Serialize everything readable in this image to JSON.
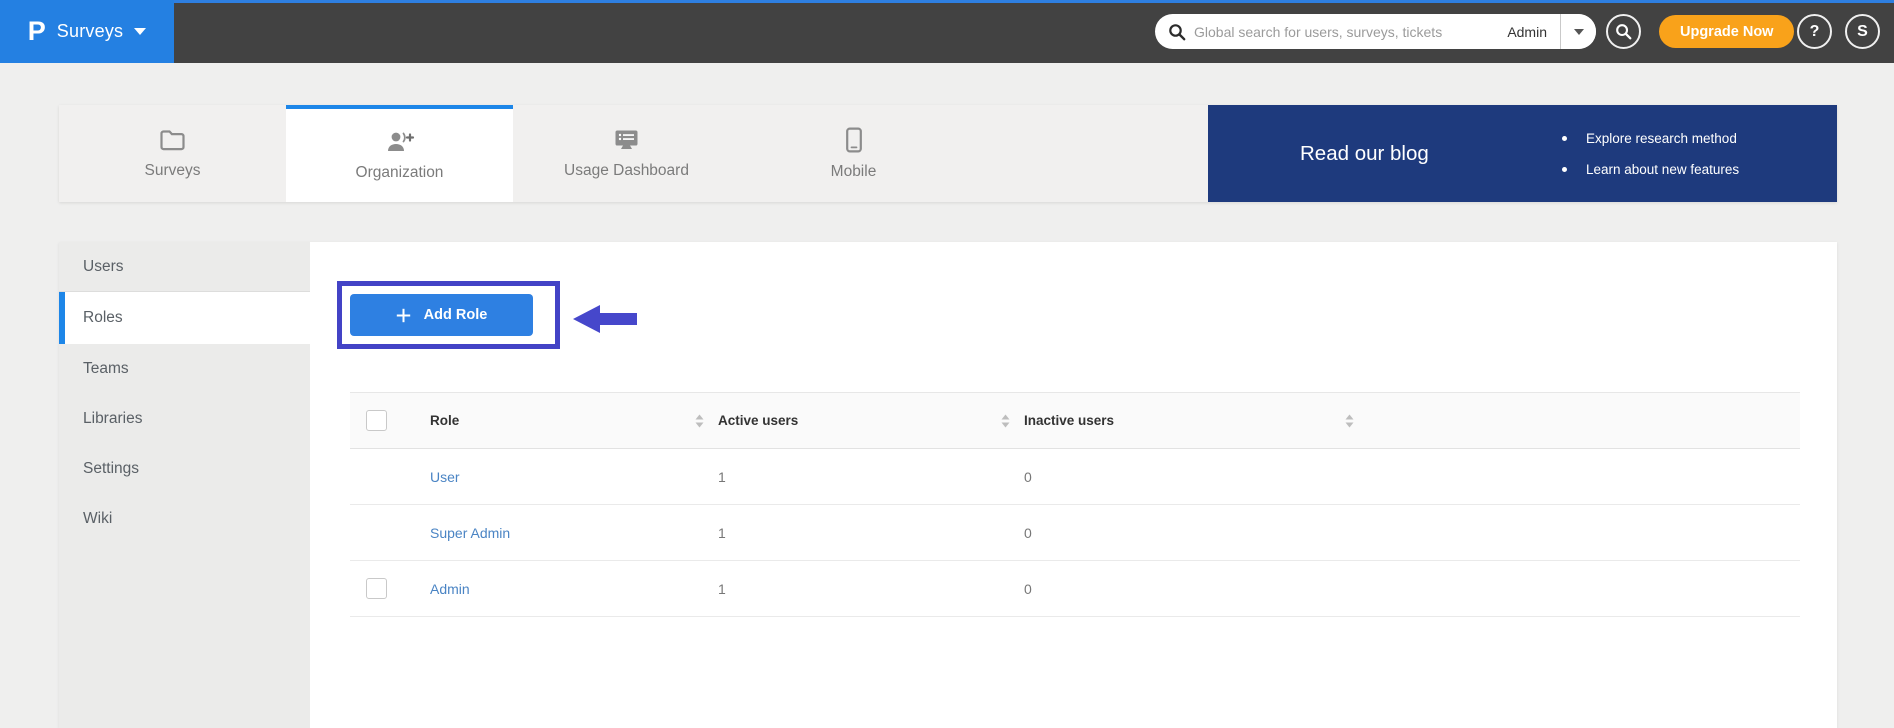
{
  "header": {
    "brand": {
      "logo_letter": "P",
      "product": "Surveys"
    },
    "search": {
      "placeholder": "Global search for users, surveys, tickets",
      "scope": "Admin"
    },
    "upgrade_label": "Upgrade Now",
    "help_label": "?",
    "avatar_label": "S"
  },
  "tabs": [
    {
      "label": "Surveys",
      "icon": "folder-icon",
      "active": false
    },
    {
      "label": "Organization",
      "icon": "user-add-icon",
      "active": true
    },
    {
      "label": "Usage Dashboard",
      "icon": "dashboard-monitor-icon",
      "active": false
    },
    {
      "label": "Mobile",
      "icon": "mobile-phone-icon",
      "active": false
    }
  ],
  "banner": {
    "title": "Read our blog",
    "bullets": [
      "Explore research method",
      "Learn about new features"
    ]
  },
  "sidebar": {
    "items": [
      {
        "label": "Users",
        "active": false
      },
      {
        "label": "Roles",
        "active": true
      },
      {
        "label": "Teams",
        "active": false
      },
      {
        "label": "Libraries",
        "active": false
      },
      {
        "label": "Settings",
        "active": false
      },
      {
        "label": "Wiki",
        "active": false
      }
    ]
  },
  "main": {
    "add_role_label": "Add Role",
    "table": {
      "columns": {
        "role": "Role",
        "active": "Active users",
        "inactive": "Inactive users"
      },
      "rows": [
        {
          "role": "User",
          "active_users": 1,
          "inactive_users": 0,
          "has_checkbox": false
        },
        {
          "role": "Super Admin",
          "active_users": 1,
          "inactive_users": 0,
          "has_checkbox": false
        },
        {
          "role": "Admin",
          "active_users": 1,
          "inactive_users": 0,
          "has_checkbox": true
        }
      ]
    }
  },
  "colors": {
    "brand_blue": "#2480e2",
    "top_strip": "#2e7fe1",
    "header_bg": "#424242",
    "active_tab_blue": "#1d86e8",
    "banner_bg": "#1e3a7d",
    "upgrade_orange": "#f9a21a",
    "annotation_indigo": "#4343c6",
    "button_blue": "#2e80e2",
    "link_blue": "#4a84c4"
  }
}
